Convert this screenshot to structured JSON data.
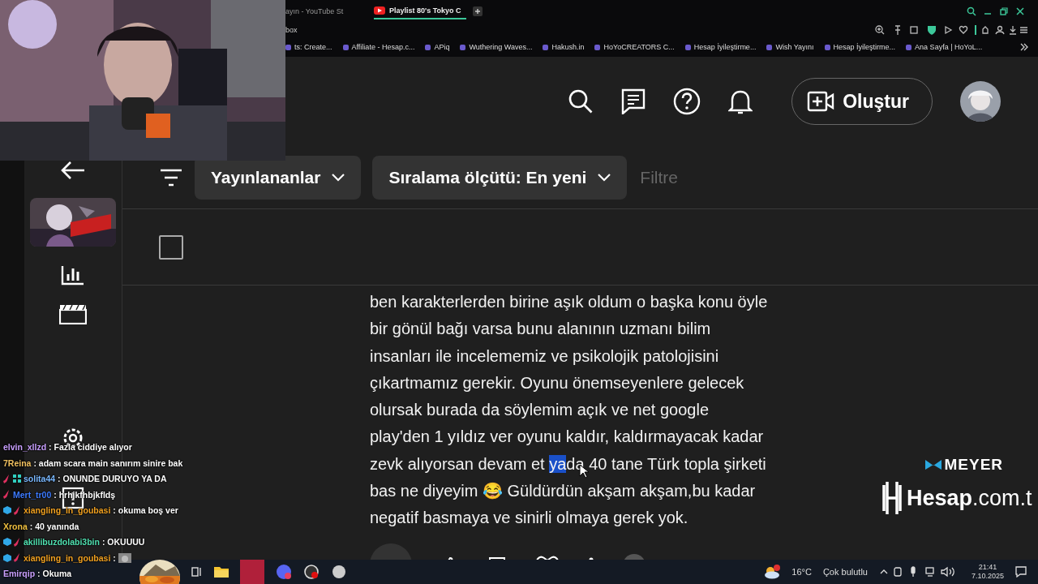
{
  "browser": {
    "tabs": [
      {
        "title": "ayın - YouTube St",
        "selected": false
      },
      {
        "title": "Playlist 80's Tokyo C",
        "selected": true
      }
    ],
    "address": "box",
    "bookmarks": [
      "ts: Create...",
      "Affiliate - Hesap.c...",
      "APiq",
      "Wuthering Waves...",
      "Hakush.in",
      "HoYoCREATORS C...",
      "Hesap İyileştirme...",
      "Wish Yayını",
      "Hesap İyileştirme...",
      "Ana Sayfa | HoYoL..."
    ]
  },
  "header": {
    "create_button": "Oluştur"
  },
  "filters": {
    "chips": [
      "Yayınlananlar",
      "Sıralama ölçütü: En yeni"
    ],
    "placeholder": "Filtre"
  },
  "select_all": {
    "checked": false
  },
  "comment": {
    "lines": [
      [
        {
          "text": "ben karakterlerden birine aşık oldum o başka konu öyle",
          "highlighted": false
        }
      ],
      [
        {
          "text": "bir gönül bağı varsa bunu alanının uzmanı bilim",
          "highlighted": false
        }
      ],
      [
        {
          "text": "insanları ile incelememiz ve psikolojik patolojisini",
          "highlighted": false
        }
      ],
      [
        {
          "text": "çıkartmamız gerekir. Oyunu önemseyenlere gelecek",
          "highlighted": false
        }
      ],
      [
        {
          "text": "olursak burada da söylemim açık ve net google",
          "highlighted": false
        }
      ],
      [
        {
          "text": "play'den 1 yıldız ver oyunu kaldır, kaldırmayacak kadar",
          "highlighted": false
        }
      ],
      [
        {
          "text": "zevk alıyorsan devam et ",
          "highlighted": false
        },
        {
          "text": "ya",
          "highlighted": true
        },
        {
          "text": "da 40 tane Türk topla şirketi",
          "highlighted": false
        }
      ],
      [
        {
          "text": "bas ne diyeyim 😂 Güldürdün akşam akşam,bu kadar",
          "highlighted": false
        }
      ],
      [
        {
          "text": "negatif basmaya ve sinirli olmaya gerek yok.",
          "highlighted": false
        }
      ]
    ],
    "reply_button": {
      "kind": "button"
    }
  },
  "sponsors": {
    "brand": "MEYER",
    "site": "Hesap",
    "site_suffix": ".com.t"
  },
  "chat": [
    {
      "user": "elvin_xllzd",
      "color": "#c9a0ff",
      "text": ": Fazla ciddiye alıyor"
    },
    {
      "user": "7Reina",
      "color": "#f0c060",
      "text": ": adam scara main sanırım sinire bak"
    },
    {
      "user": "solita44",
      "color": "#7ab8ff",
      "badges": [
        {
          "kind": "sword"
        },
        {
          "kind": "grid"
        }
      ],
      "text": ": ONUNDE DURUYO YA DA"
    },
    {
      "user": "Mert_tr00",
      "color": "#3d7bff",
      "badges": [
        {
          "kind": "sword"
        }
      ],
      "text": ": hrhjkfhbjkfldş"
    },
    {
      "user": "xiangling_in_goubasi",
      "color": "#f0a020",
      "badges": [
        {
          "kind": "cube"
        },
        {
          "kind": "sword"
        }
      ],
      "text": ": okuma boş ver"
    },
    {
      "user": "Xrona",
      "color": "#f0c040",
      "text": ": 40 yanında"
    },
    {
      "user": "akillibuzdolabi3bin",
      "color": "#50e0b0",
      "badges": [
        {
          "kind": "cube"
        },
        {
          "kind": "sword"
        }
      ],
      "text": ": OKUUUU"
    },
    {
      "user": "xiangling_in_goubasi",
      "color": "#f0a020",
      "badges": [
        {
          "kind": "cube"
        },
        {
          "kind": "sword"
        }
      ],
      "kind": "emote",
      "text": ":"
    },
    {
      "user": "Emirqip",
      "color": "#c9a0ff",
      "text": ": Okuma"
    }
  ],
  "taskbar": {
    "temperature": "16°C",
    "weather": "Çok bulutlu",
    "time": "21:41",
    "date": "7.10.2025"
  }
}
